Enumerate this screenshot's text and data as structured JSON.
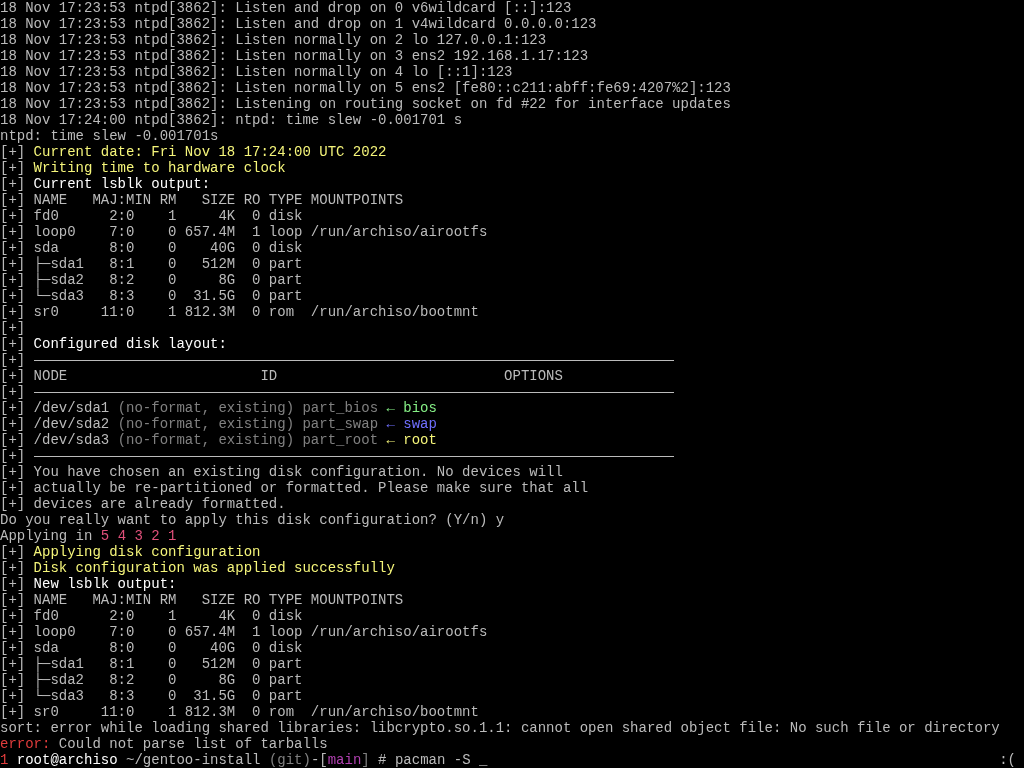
{
  "lines": [
    {
      "segments": [
        {
          "text": "18 Nov 17:23:53 ntpd[3862]: Listen and drop on 0 v6wildcard [::]:123",
          "color": "#bbbbbb"
        }
      ]
    },
    {
      "segments": [
        {
          "text": "18 Nov 17:23:53 ntpd[3862]: Listen and drop on 1 v4wildcard 0.0.0.0:123",
          "color": "#bbbbbb"
        }
      ]
    },
    {
      "segments": [
        {
          "text": "18 Nov 17:23:53 ntpd[3862]: Listen normally on 2 lo 127.0.0.1:123",
          "color": "#bbbbbb"
        }
      ]
    },
    {
      "segments": [
        {
          "text": "18 Nov 17:23:53 ntpd[3862]: Listen normally on 3 ens2 192.168.1.17:123",
          "color": "#bbbbbb"
        }
      ]
    },
    {
      "segments": [
        {
          "text": "18 Nov 17:23:53 ntpd[3862]: Listen normally on 4 lo [::1]:123",
          "color": "#bbbbbb"
        }
      ]
    },
    {
      "segments": [
        {
          "text": "18 Nov 17:23:53 ntpd[3862]: Listen normally on 5 ens2 [fe80::c211:abff:fe69:4207%2]:123",
          "color": "#bbbbbb"
        }
      ]
    },
    {
      "segments": [
        {
          "text": "18 Nov 17:23:53 ntpd[3862]: Listening on routing socket on fd #22 for interface updates",
          "color": "#bbbbbb"
        }
      ]
    },
    {
      "segments": [
        {
          "text": "18 Nov 17:24:00 ntpd[3862]: ntpd: time slew -0.001701 s",
          "color": "#bbbbbb"
        }
      ]
    },
    {
      "segments": [
        {
          "text": "ntpd: time slew -0.001701s",
          "color": "#bbbbbb"
        }
      ]
    },
    {
      "segments": [
        {
          "text": "[+] ",
          "color": "#bbbbbb"
        },
        {
          "text": "Current date: Fri Nov 18 17:24:00 UTC 2022",
          "color": "#f5f57a"
        }
      ]
    },
    {
      "segments": [
        {
          "text": "[+] ",
          "color": "#bbbbbb"
        },
        {
          "text": "Writing time to hardware clock",
          "color": "#f5f57a"
        }
      ]
    },
    {
      "segments": [
        {
          "text": "[+] ",
          "color": "#bbbbbb"
        },
        {
          "text": "Current lsblk output:",
          "color": "#ffffff"
        }
      ]
    },
    {
      "segments": [
        {
          "text": "[+] NAME   MAJ:MIN RM   SIZE RO TYPE MOUNTPOINTS",
          "color": "#bbbbbb"
        }
      ]
    },
    {
      "segments": [
        {
          "text": "[+] fd0      2:0    1     4K  0 disk",
          "color": "#bbbbbb"
        }
      ]
    },
    {
      "segments": [
        {
          "text": "[+] loop0    7:0    0 657.4M  1 loop /run/archiso/airootfs",
          "color": "#bbbbbb"
        }
      ]
    },
    {
      "segments": [
        {
          "text": "[+] sda      8:0    0    40G  0 disk",
          "color": "#bbbbbb"
        }
      ]
    },
    {
      "segments": [
        {
          "text": "[+] ├─sda1   8:1    0   512M  0 part",
          "color": "#bbbbbb"
        }
      ]
    },
    {
      "segments": [
        {
          "text": "[+] ├─sda2   8:2    0     8G  0 part",
          "color": "#bbbbbb"
        }
      ]
    },
    {
      "segments": [
        {
          "text": "[+] └─sda3   8:3    0  31.5G  0 part",
          "color": "#bbbbbb"
        }
      ]
    },
    {
      "segments": [
        {
          "text": "[+] sr0     11:0    1 812.3M  0 rom  /run/archiso/bootmnt",
          "color": "#bbbbbb"
        }
      ]
    },
    {
      "segments": [
        {
          "text": "[+]",
          "color": "#bbbbbb"
        }
      ]
    },
    {
      "segments": [
        {
          "text": "[+] ",
          "color": "#bbbbbb"
        },
        {
          "text": "Configured disk layout:",
          "color": "#ffffff"
        }
      ]
    },
    {
      "segments": [
        {
          "text": "[+] ",
          "color": "#bbbbbb"
        }
      ],
      "rule": true
    },
    {
      "segments": [
        {
          "text": "[+] NODE                       ID                           OPTIONS",
          "color": "#bbbbbb"
        }
      ]
    },
    {
      "segments": [
        {
          "text": "[+] ",
          "color": "#bbbbbb"
        }
      ],
      "rule": true
    },
    {
      "segments": [
        {
          "text": "[+] /dev/sda1 ",
          "color": "#bbbbbb"
        },
        {
          "text": "(no-format, existing) part_bios ",
          "color": "#808080"
        },
        {
          "text": "← bios",
          "color": "#86f086"
        }
      ]
    },
    {
      "segments": [
        {
          "text": "[+] /dev/sda2 ",
          "color": "#bbbbbb"
        },
        {
          "text": "(no-format, existing) part_swap ",
          "color": "#808080"
        },
        {
          "text": "← swap",
          "color": "#7070ff"
        }
      ]
    },
    {
      "segments": [
        {
          "text": "[+] /dev/sda3 ",
          "color": "#bbbbbb"
        },
        {
          "text": "(no-format, existing) part_root ",
          "color": "#808080"
        },
        {
          "text": "← root",
          "color": "#f5f57a"
        }
      ]
    },
    {
      "segments": [
        {
          "text": "[+] ",
          "color": "#bbbbbb"
        }
      ],
      "rule": true
    },
    {
      "segments": [
        {
          "text": "[+] You have chosen an existing disk configuration. No devices will",
          "color": "#bbbbbb"
        }
      ]
    },
    {
      "segments": [
        {
          "text": "[+] actually be re-partitioned or formatted. Please make sure that all",
          "color": "#bbbbbb"
        }
      ]
    },
    {
      "segments": [
        {
          "text": "[+] devices are already formatted.",
          "color": "#bbbbbb"
        }
      ]
    },
    {
      "segments": [
        {
          "text": "Do you really want to apply this disk configuration? (Y/n) y",
          "color": "#bbbbbb"
        }
      ]
    },
    {
      "segments": [
        {
          "text": "Applying in ",
          "color": "#bbbbbb"
        },
        {
          "text": "5 4 3 2 1",
          "color": "#e0507a"
        }
      ]
    },
    {
      "segments": [
        {
          "text": "[+] ",
          "color": "#bbbbbb"
        },
        {
          "text": "Applying disk configuration",
          "color": "#f5f57a"
        }
      ]
    },
    {
      "segments": [
        {
          "text": "[+] ",
          "color": "#bbbbbb"
        },
        {
          "text": "Disk configuration was applied successfully",
          "color": "#f5f57a"
        }
      ]
    },
    {
      "segments": [
        {
          "text": "[+] ",
          "color": "#bbbbbb"
        },
        {
          "text": "New lsblk output:",
          "color": "#ffffff"
        }
      ]
    },
    {
      "segments": [
        {
          "text": "[+] NAME   MAJ:MIN RM   SIZE RO TYPE MOUNTPOINTS",
          "color": "#bbbbbb"
        }
      ]
    },
    {
      "segments": [
        {
          "text": "[+] fd0      2:0    1     4K  0 disk",
          "color": "#bbbbbb"
        }
      ]
    },
    {
      "segments": [
        {
          "text": "[+] loop0    7:0    0 657.4M  1 loop /run/archiso/airootfs",
          "color": "#bbbbbb"
        }
      ]
    },
    {
      "segments": [
        {
          "text": "[+] sda      8:0    0    40G  0 disk",
          "color": "#bbbbbb"
        }
      ]
    },
    {
      "segments": [
        {
          "text": "[+] ├─sda1   8:1    0   512M  0 part",
          "color": "#bbbbbb"
        }
      ]
    },
    {
      "segments": [
        {
          "text": "[+] ├─sda2   8:2    0     8G  0 part",
          "color": "#bbbbbb"
        }
      ]
    },
    {
      "segments": [
        {
          "text": "[+] └─sda3   8:3    0  31.5G  0 part",
          "color": "#bbbbbb"
        }
      ]
    },
    {
      "segments": [
        {
          "text": "[+] sr0     11:0    1 812.3M  0 rom  /run/archiso/bootmnt",
          "color": "#bbbbbb"
        }
      ]
    },
    {
      "segments": [
        {
          "text": "sort: error while loading shared libraries: libcrypto.so.1.1: cannot open shared object file: No such file or directory",
          "color": "#bbbbbb"
        }
      ]
    },
    {
      "segments": [
        {
          "text": "error:",
          "color": "#e03c3c"
        },
        {
          "text": " Could not parse list of tarballs",
          "color": "#bbbbbb"
        }
      ]
    },
    {
      "segments": [
        {
          "text": "1 ",
          "color": "#e03c3c"
        },
        {
          "text": "root@archiso",
          "color": "#ffffff"
        },
        {
          "text": " ~/gentoo-install ",
          "color": "#bbbbbb"
        },
        {
          "text": "(git)",
          "color": "#808080"
        },
        {
          "text": "-[",
          "color": "#bbbbbb"
        },
        {
          "text": "main",
          "color": "#b040b0"
        },
        {
          "text": "]",
          "color": "#808080"
        },
        {
          "text": " # pacman -S ",
          "color": "#bbbbbb"
        }
      ],
      "cursor": "_",
      "right": ":("
    }
  ]
}
